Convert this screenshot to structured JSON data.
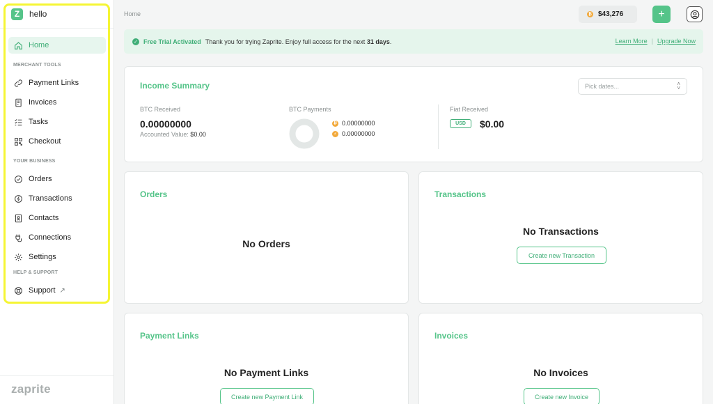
{
  "brand": {
    "logo_letter": "Z",
    "name": "hello"
  },
  "sidebar": {
    "home": "Home",
    "sections": {
      "merchant": "MERCHANT TOOLS",
      "business": "YOUR BUSINESS",
      "help": "HELP & SUPPORT"
    },
    "items": {
      "payment_links": "Payment Links",
      "invoices": "Invoices",
      "tasks": "Tasks",
      "checkout": "Checkout",
      "orders": "Orders",
      "transactions": "Transactions",
      "contacts": "Contacts",
      "connections": "Connections",
      "settings": "Settings",
      "support": "Support"
    },
    "footer_logo": "zaprite"
  },
  "topbar": {
    "breadcrumb": "Home",
    "btc_price": "$43,276",
    "add_label": "+"
  },
  "banner": {
    "title": "Free Trial Activated",
    "message": "Thank you for trying Zaprite. Enjoy full access for the next",
    "days": "31 days",
    "period": ".",
    "learn_more": "Learn More",
    "separator": "|",
    "upgrade": "Upgrade Now"
  },
  "income": {
    "title": "Income Summary",
    "date_placeholder": "Pick dates...",
    "btc_received_label": "BTC Received",
    "btc_received_value": "0.00000000",
    "accounted_label": "Accounted Value:",
    "accounted_value": "$0.00",
    "btc_payments_label": "BTC Payments",
    "btc_onchain": "0.00000000",
    "btc_lightning": "0.00000000",
    "fiat_label": "Fiat Received",
    "fiat_currency": "USD",
    "fiat_value": "$0.00"
  },
  "orders": {
    "title": "Orders",
    "empty": "No Orders"
  },
  "transactions": {
    "title": "Transactions",
    "empty": "No Transactions",
    "button": "Create new Transaction"
  },
  "payment_links": {
    "title": "Payment Links",
    "empty": "No Payment Links",
    "button": "Create new Payment Link"
  },
  "invoices": {
    "title": "Invoices",
    "empty": "No Invoices",
    "button": "Create new Invoice"
  },
  "colors": {
    "accent": "#55c489",
    "accent_dark": "#3fae77",
    "banner_bg": "#e5f5ec",
    "highlight": "#f5f534",
    "bitcoin": "#f2a93b"
  }
}
